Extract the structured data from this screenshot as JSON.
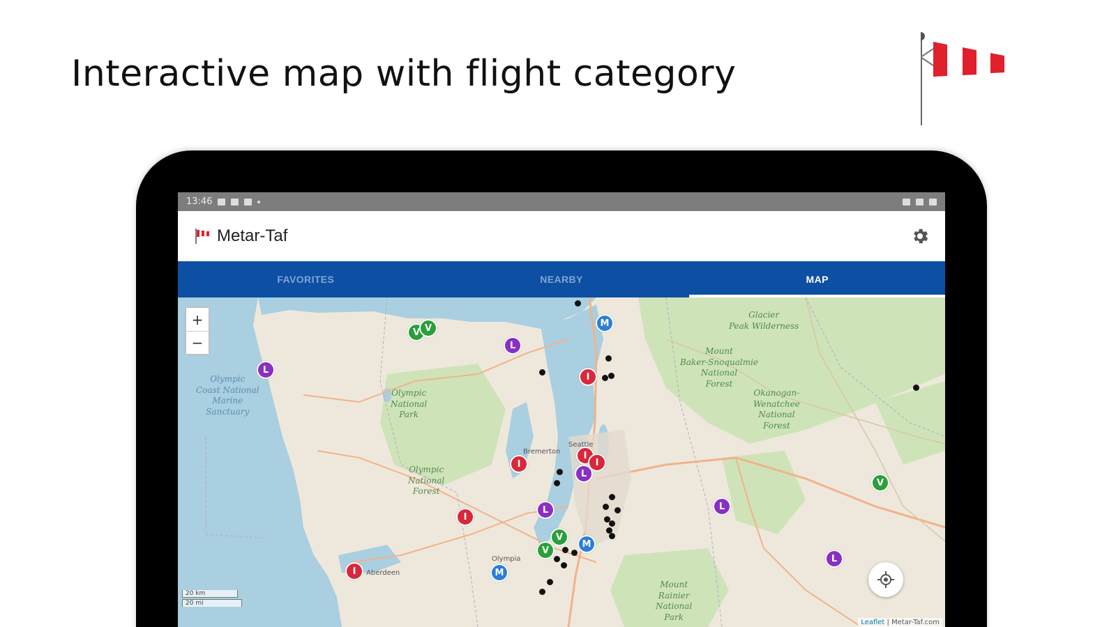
{
  "headline": "Interactive map with flight category",
  "status_bar": {
    "time": "13:46"
  },
  "app": {
    "title": "Metar-Taf"
  },
  "tabs": [
    {
      "label": "FAVORITES",
      "active": false
    },
    {
      "label": "NEARBY",
      "active": false
    },
    {
      "label": "MAP",
      "active": true
    }
  ],
  "map": {
    "zoom_in_label": "+",
    "zoom_out_label": "−",
    "scale": [
      "20 km",
      "20 mi"
    ],
    "attribution_link": "Leaflet",
    "attribution_rest": " | Metar-Taf.com",
    "places": {
      "coast": "Olympic\nCoast National\nMarine\nSanctuary",
      "olympic_np": "Olympic\nNational\nPark",
      "olympic_nf": "Olympic\nNational\nForest",
      "glacier": "Glacier\nPeak Wilderness",
      "baker": "Mount\nBaker-Snoqualmie\nNational\nForest",
      "okanogan": "Okanogan-\nWenatchee\nNational\nForest",
      "rainier": "Mount\nRainier\nNational\nPark",
      "seattle": "Seattle",
      "bremerton": "Bremerton",
      "olympia": "Olympia",
      "aberdeen": "Aberdeen"
    },
    "markers": [
      {
        "label": "V",
        "category": "VFR"
      },
      {
        "label": "V",
        "category": "VFR"
      },
      {
        "label": "L",
        "category": "LIFR"
      },
      {
        "label": "L",
        "category": "LIFR"
      },
      {
        "label": "M",
        "category": "MVFR"
      },
      {
        "label": "I",
        "category": "IFR"
      },
      {
        "label": "I",
        "category": "IFR"
      },
      {
        "label": "I",
        "category": "IFR"
      },
      {
        "label": "I",
        "category": "IFR"
      },
      {
        "label": "L",
        "category": "LIFR"
      },
      {
        "label": "L",
        "category": "LIFR"
      },
      {
        "label": "I",
        "category": "IFR"
      },
      {
        "label": "V",
        "category": "VFR"
      },
      {
        "label": "V",
        "category": "VFR"
      },
      {
        "label": "M",
        "category": "MVFR"
      },
      {
        "label": "I",
        "category": "IFR"
      },
      {
        "label": "M",
        "category": "MVFR"
      },
      {
        "label": "L",
        "category": "LIFR"
      },
      {
        "label": "V",
        "category": "VFR"
      },
      {
        "label": "L",
        "category": "LIFR"
      }
    ]
  },
  "colors": {
    "tab_bar": "#0d4fa3",
    "VFR": "#2aa03a",
    "MVFR": "#2a7fd6",
    "IFR": "#d9283a",
    "LIFR": "#8a2fc4",
    "water": "#a9cfe0",
    "land": "#eee8dc",
    "forest": "#cfe3b9"
  },
  "icons": {
    "windsock": "windsock-icon",
    "settings": "gear-icon",
    "locate": "crosshair-icon"
  }
}
